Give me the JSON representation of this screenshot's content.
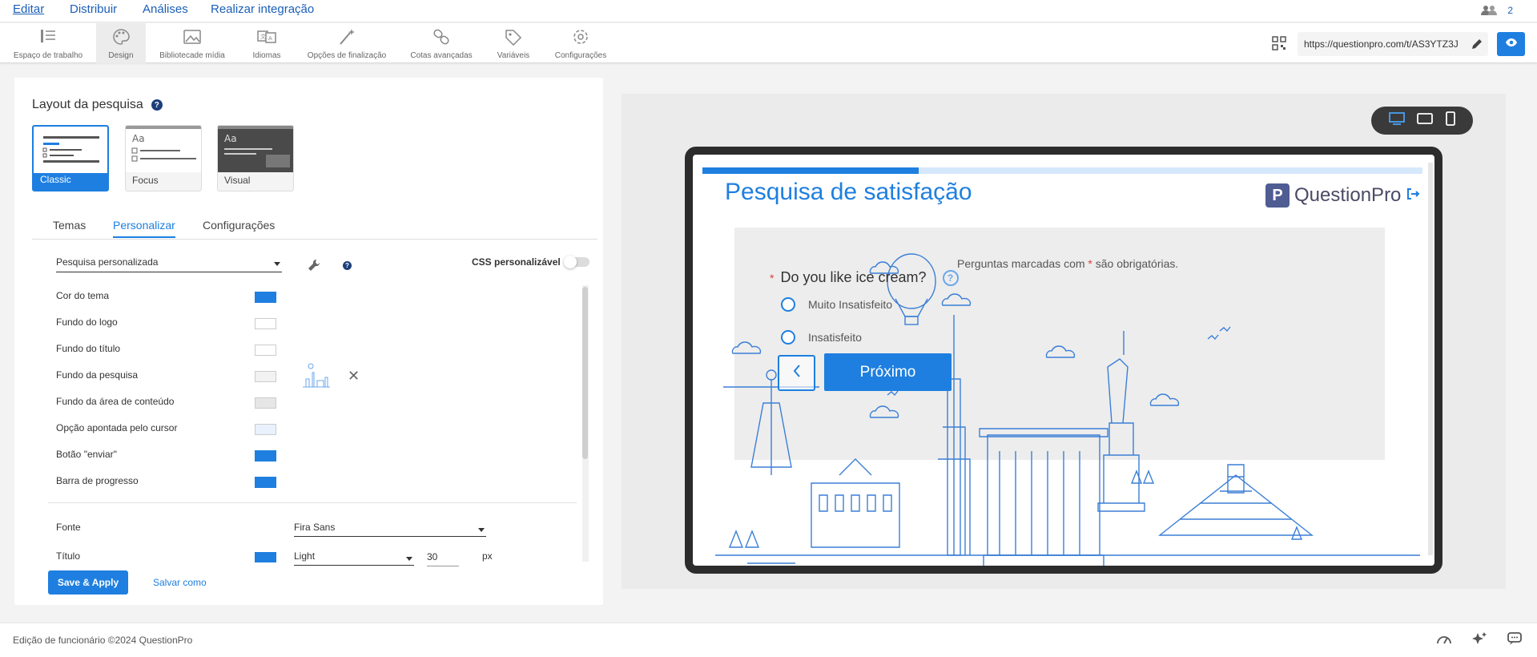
{
  "topnav": {
    "items": [
      "Editar",
      "Distribuir",
      "Análises",
      "Realizar integração"
    ],
    "active": "Editar",
    "user_count": "2"
  },
  "toolbar": {
    "tools": [
      {
        "label": "Espaço de trabalho",
        "icon": "workspace-icon"
      },
      {
        "label": "Design",
        "icon": "palette-icon"
      },
      {
        "label": "Bibliotecade mídia",
        "icon": "image-icon"
      },
      {
        "label": "Idiomas",
        "icon": "translate-icon"
      },
      {
        "label": "Opções de finalização",
        "icon": "magic-wand-icon"
      },
      {
        "label": "Cotas avançadas",
        "icon": "link-icon"
      },
      {
        "label": "Variáveis",
        "icon": "tag-icon"
      },
      {
        "label": "Configurações",
        "icon": "gear-icon"
      }
    ],
    "active": "Design",
    "url": "https://questionpro.com/t/AS3YTZ3J"
  },
  "layout": {
    "title": "Layout da pesquisa",
    "options": [
      "Classic",
      "Focus",
      "Visual"
    ],
    "selected": "Classic"
  },
  "tabs": {
    "items": [
      "Temas",
      "Personalizar",
      "Configurações"
    ],
    "active": "Personalizar"
  },
  "customize": {
    "theme_value": "Pesquisa personalizada",
    "css_label": "CSS personalizável",
    "css_enabled": false,
    "colors": [
      {
        "label": "Cor do tema",
        "color": "#1e7fe0"
      },
      {
        "label": "Fundo do logo",
        "color": "#ffffff"
      },
      {
        "label": "Fundo do título",
        "color": "#ffffff"
      },
      {
        "label": "Fundo da pesquisa",
        "color": "#f2f2f2"
      },
      {
        "label": "Fundo da área de conteúdo",
        "color": "#e6e6e6"
      },
      {
        "label": "Opção apontada pelo cursor",
        "color": "#e8f1fc"
      },
      {
        "label": "Botão \"enviar\"",
        "color": "#1e7fe0"
      },
      {
        "label": "Barra de progresso",
        "color": "#1e7fe0"
      }
    ],
    "font_label": "Fonte",
    "font_value": "Fira Sans",
    "title_label": "Título",
    "title_color": "#1e7fe0",
    "title_weight": "Light",
    "title_size": "30",
    "title_unit": "px"
  },
  "actions": {
    "save": "Save & Apply",
    "save_as": "Salvar como"
  },
  "preview": {
    "survey_title": "Pesquisa de satisfação",
    "logo_text": "QuestionPro",
    "required_note_before": "Perguntas marcadas com",
    "required_star": "*",
    "required_note_after": "são obrigatórias.",
    "question": "Do you like ice cream?",
    "options": [
      "Muito Insatisfeito",
      "Insatisfeito"
    ],
    "next_label": "Próximo",
    "progress": 0.3
  },
  "footer": {
    "copyright": "Edição de funcionário ©2024 QuestionPro"
  }
}
